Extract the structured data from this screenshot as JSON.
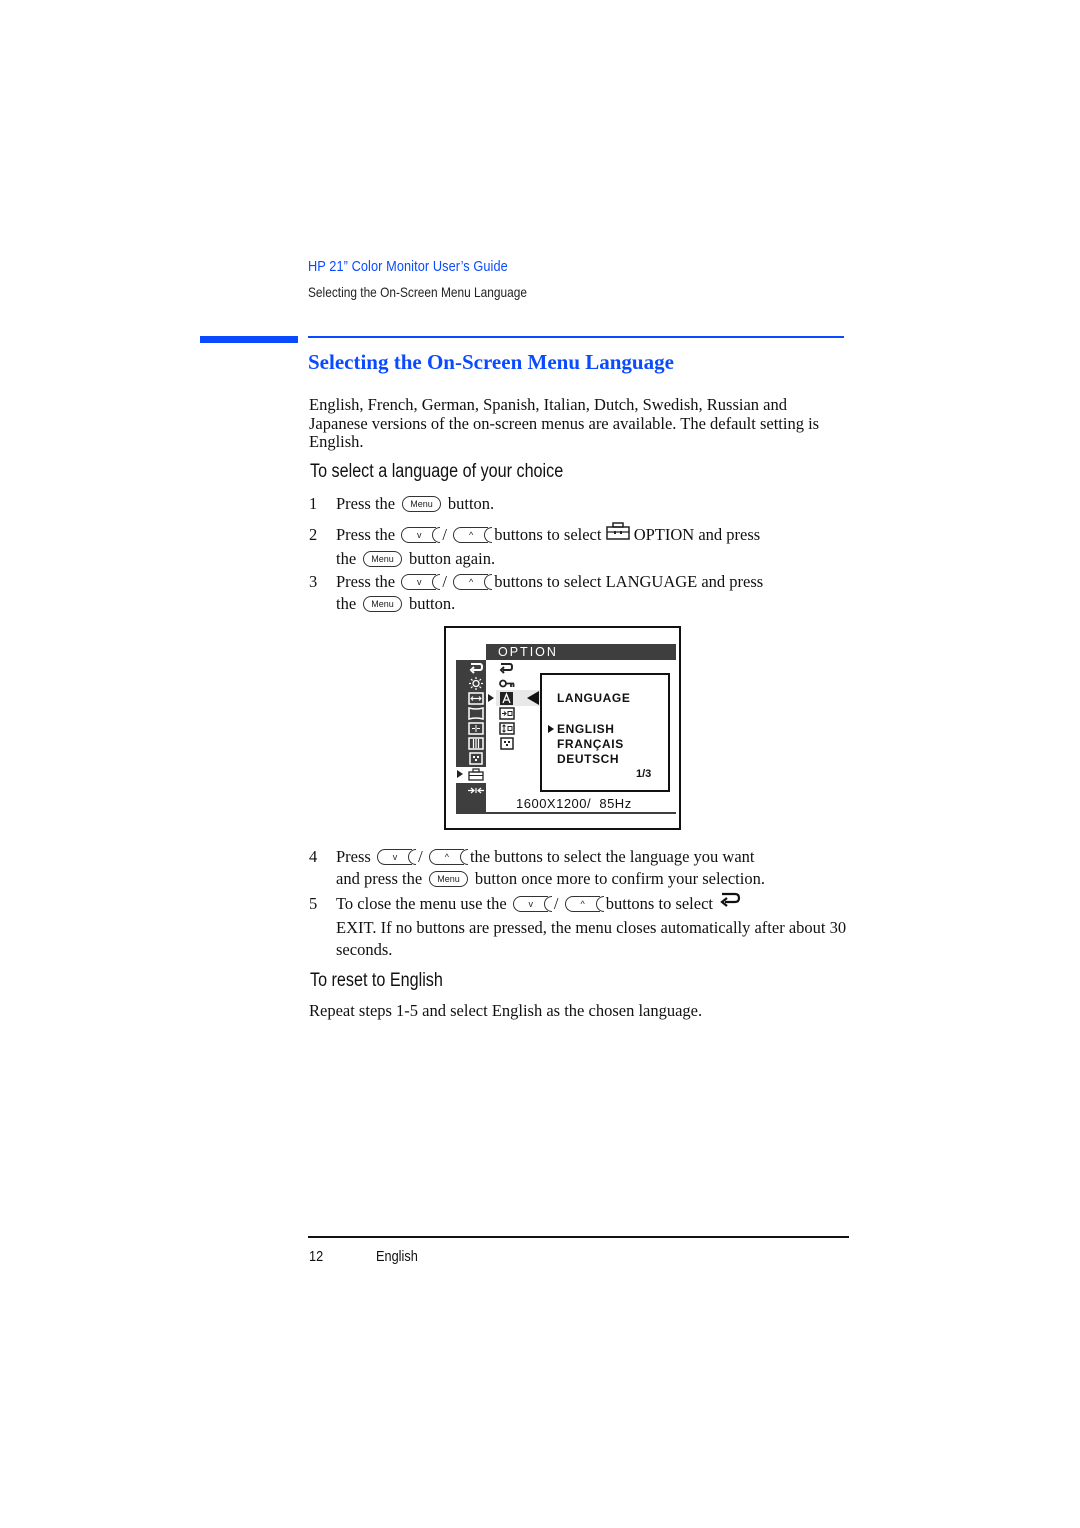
{
  "header": {
    "guide_title": "HP 21” Color Monitor User’s Guide",
    "section_running": "Selecting the On-Screen Menu Language"
  },
  "colors": {
    "accent": "#0a4bff",
    "osd_dark": "#3e3e3e"
  },
  "section": {
    "title": "Selecting the On-Screen Menu Language",
    "intro": "English, French, German, Spanish, Italian, Dutch, Swedish, Russian and Japanese versions of the on-screen menus are available. The default setting is English."
  },
  "procedure": {
    "heading": "To select a language of your choice",
    "steps": [
      {
        "num": "1",
        "a": "Press the",
        "b": "button."
      },
      {
        "num": "2",
        "a": "Press the",
        "sep": "/",
        "b": "buttons to select",
        "c": "OPTION and press",
        "d": "the",
        "e": "button again."
      },
      {
        "num": "3",
        "a": "Press the",
        "sep": "/",
        "b": "buttons to select LANGUAGE and press",
        "d": "the",
        "e": "button."
      },
      {
        "num": "4",
        "a": "Press",
        "sep": "/",
        "b": "the buttons to select the language you want",
        "d": "and press the",
        "e": "button once more to confirm your selection."
      },
      {
        "num": "5",
        "a": "To close the menu use the",
        "sep": "/",
        "b": "buttons to select",
        "e": "EXIT. If no buttons are pressed, the menu closes automatically after about 30 seconds."
      }
    ]
  },
  "keys": {
    "menu": "Menu",
    "down": "v",
    "up": "^"
  },
  "icons": {
    "option": "toolbox-icon",
    "exit": "exit-return-icon"
  },
  "osd": {
    "header": "OPTION",
    "submenu_title": "LANGUAGE",
    "options": [
      "ENGLISH",
      "FRANÇAIS",
      "DEUTSCH"
    ],
    "selected_option": "ENGLISH",
    "page": "1/3",
    "status": "1600X1200/  85Hz",
    "left_icons": [
      "exit-icon",
      "brightness-icon",
      "size-icon",
      "geometry-icon",
      "convergence-icon",
      "color-icon",
      "moire-icon",
      "option-icon",
      "reset-icon"
    ],
    "option_icons": [
      "exit-icon",
      "key-lock-icon",
      "language-icon",
      "h-position-icon",
      "v-position-icon",
      "degauss-icon"
    ]
  },
  "reset": {
    "heading": "To reset to English",
    "text": "Repeat steps 1-5 and select English as the chosen language."
  },
  "footer": {
    "page_number": "12",
    "language": "English"
  }
}
